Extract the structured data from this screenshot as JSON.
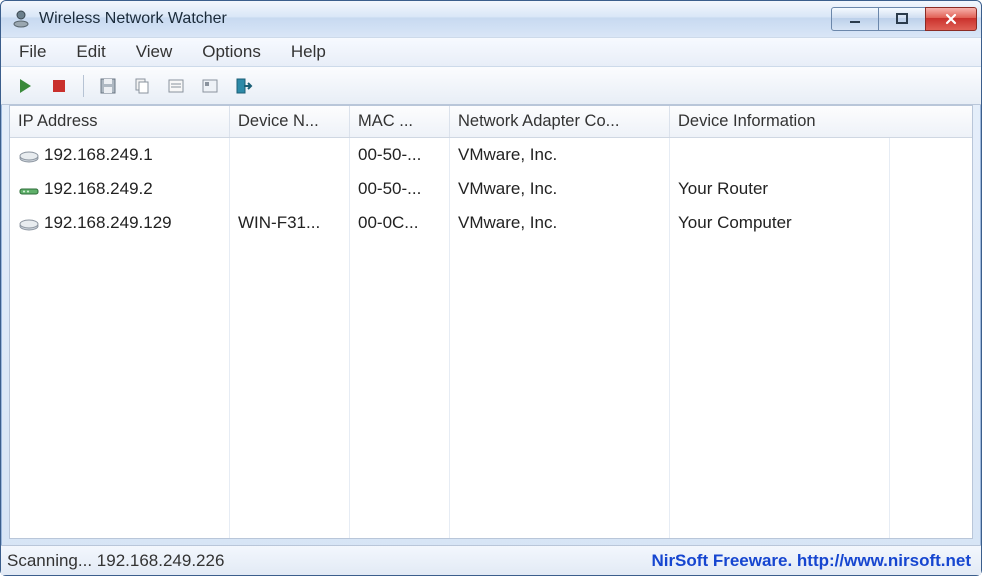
{
  "title": "Wireless Network Watcher",
  "menu": {
    "file": "File",
    "edit": "Edit",
    "view": "View",
    "options": "Options",
    "help": "Help"
  },
  "columns": {
    "ip": "IP Address",
    "device_name": "Device N...",
    "mac": "MAC ...",
    "adapter": "Network Adapter Co...",
    "info": "Device Information"
  },
  "rows": [
    {
      "ip": "192.168.249.1",
      "device_name": "",
      "mac": "00-50-...",
      "adapter": "VMware, Inc.",
      "info": ""
    },
    {
      "ip": "192.168.249.2",
      "device_name": "",
      "mac": "00-50-...",
      "adapter": "VMware, Inc.",
      "info": "Your Router"
    },
    {
      "ip": "192.168.249.129",
      "device_name": "WIN-F31...",
      "mac": "00-0C...",
      "adapter": "VMware, Inc.",
      "info": "Your Computer"
    }
  ],
  "status": {
    "left": "Scanning... 192.168.249.226",
    "link": "NirSoft Freeware.  http://www.nirsoft.net"
  }
}
